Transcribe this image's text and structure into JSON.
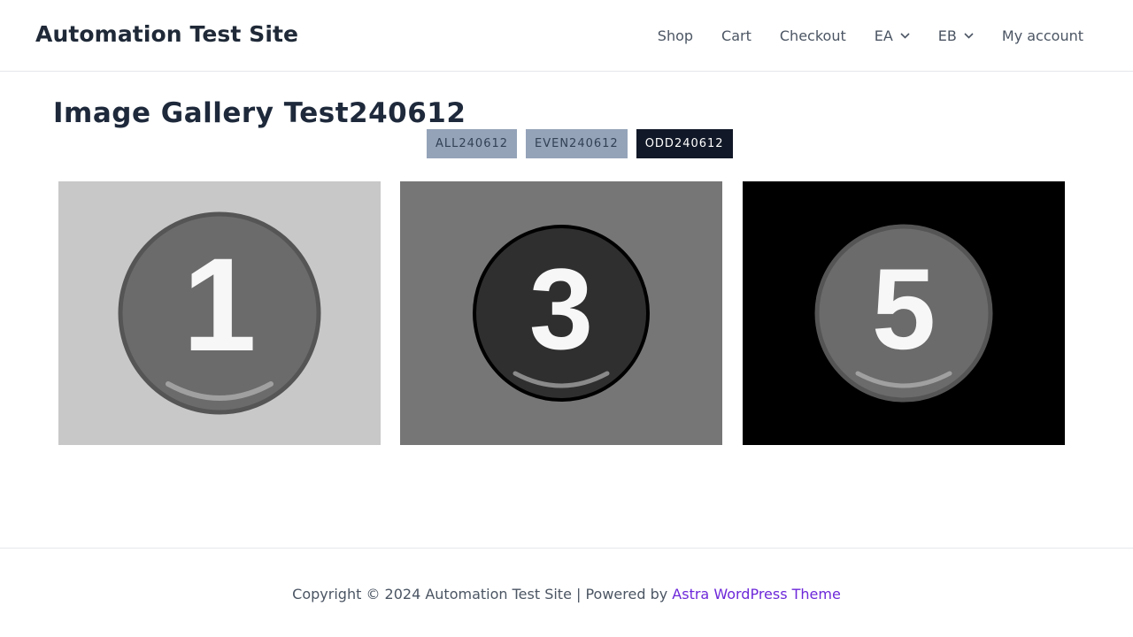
{
  "header": {
    "site_title": "Automation Test Site",
    "nav": [
      "Shop",
      "Cart",
      "Checkout",
      "EA",
      "EB",
      "My account"
    ]
  },
  "page": {
    "title": "Image Gallery Test240612"
  },
  "filters": [
    {
      "label": "ALL240612",
      "active": false
    },
    {
      "label": "EVEN240612",
      "active": false
    },
    {
      "label": "ODD240612",
      "active": true
    }
  ],
  "gallery": [
    {
      "number": "1",
      "background": "#c8c8c8",
      "circle_fill": "#6b6b6b",
      "circle_stroke": "#555555"
    },
    {
      "number": "3",
      "background": "#767676",
      "circle_fill": "#2f2f2f",
      "circle_stroke": "#000000"
    },
    {
      "number": "5",
      "background": "#000000",
      "circle_fill": "#6b6b6b",
      "circle_stroke": "#555555"
    }
  ],
  "footer": {
    "text": "Copyright © 2024 Automation Test Site | Powered by ",
    "link_text": "Astra WordPress Theme",
    "link_color": "#6d28d9"
  }
}
